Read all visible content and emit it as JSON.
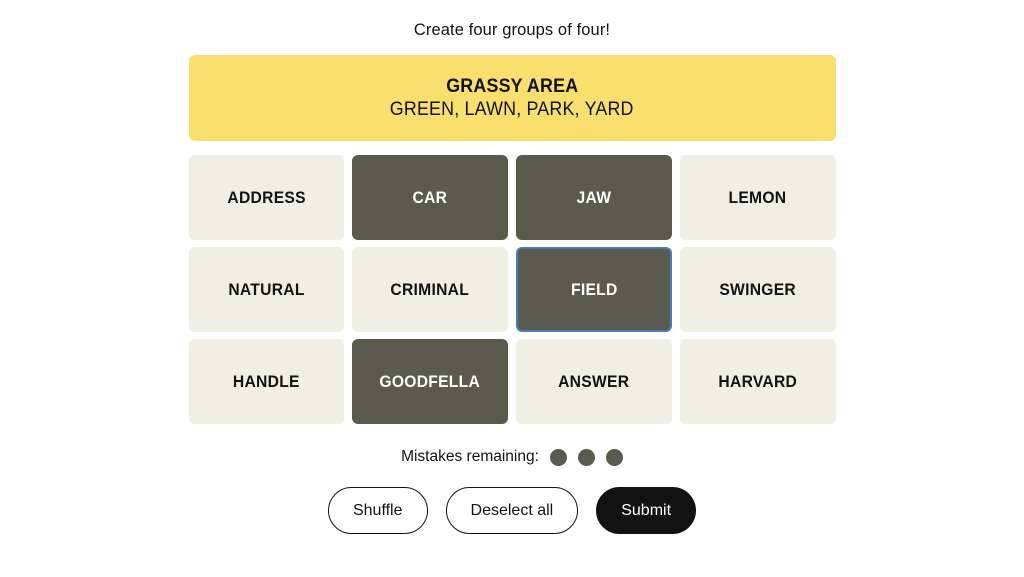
{
  "game": {
    "prompt": "Create four groups of four!"
  },
  "solved_groups": [
    {
      "title": "GRASSY AREA",
      "words": "GREEN, LAWN, PARK, YARD",
      "color": "#f9df6d"
    }
  ],
  "grid": {
    "rows": [
      [
        {
          "label": "ADDRESS",
          "state": "unselected",
          "focused": false
        },
        {
          "label": "CAR",
          "state": "selected",
          "focused": false
        },
        {
          "label": "JAW",
          "state": "selected",
          "focused": false
        },
        {
          "label": "LEMON",
          "state": "unselected",
          "focused": false
        }
      ],
      [
        {
          "label": "NATURAL",
          "state": "unselected",
          "focused": false
        },
        {
          "label": "CRIMINAL",
          "state": "unselected",
          "focused": false
        },
        {
          "label": "FIELD",
          "state": "selected",
          "focused": true
        },
        {
          "label": "SWINGER",
          "state": "unselected",
          "focused": false
        }
      ],
      [
        {
          "label": "HANDLE",
          "state": "unselected",
          "focused": false
        },
        {
          "label": "GOODFELLA",
          "state": "selected",
          "focused": false
        },
        {
          "label": "ANSWER",
          "state": "unselected",
          "focused": false
        },
        {
          "label": "HARVARD",
          "state": "unselected",
          "focused": false
        }
      ]
    ]
  },
  "mistakes": {
    "label": "Mistakes remaining:",
    "remaining": 3,
    "dot_color": "#5a5a4e"
  },
  "controls": {
    "shuffle_label": "Shuffle",
    "deselect_label": "Deselect all",
    "submit_label": "Submit"
  },
  "colors": {
    "tile_unselected": "#efefe6",
    "tile_selected": "#5a5a4e",
    "focus_ring": "#4a7ebb",
    "text_dark": "#121212",
    "page_background": "#ffffff"
  }
}
